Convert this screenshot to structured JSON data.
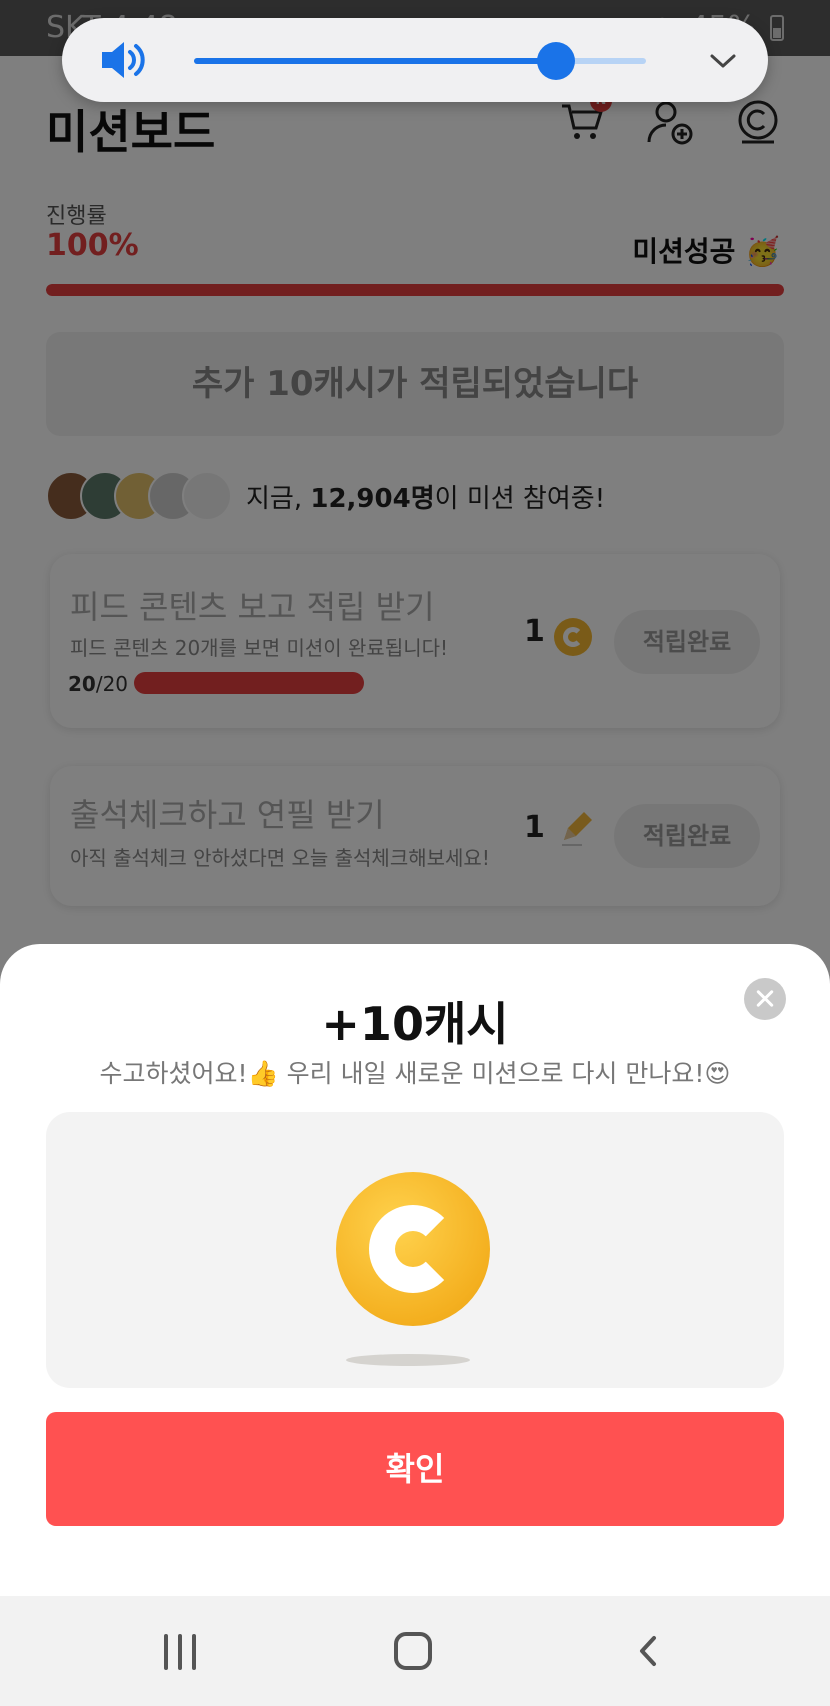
{
  "status_bar": {
    "carrier_time": "SKT 4:48",
    "battery": "45%"
  },
  "volume": {
    "level": 0.8
  },
  "page": {
    "title": "미션보드",
    "cart_badge": "N",
    "progress_label": "진행률",
    "progress_value": "100%",
    "progress_fraction": 1.0,
    "success_text": "미션성공 🥳",
    "bonus_message": "추가 10캐시가 적립되었습니다",
    "participants_prefix": "지금, ",
    "participants_count": "12,904명",
    "participants_suffix": "이 미션 참여중!"
  },
  "missions": [
    {
      "title": "피드 콘텐츠 보고 적립 받기",
      "description": "피드 콘텐츠 20개를 보면 미션이 완료됩니다!",
      "count_done": "20",
      "count_total": "/20",
      "reward": "1",
      "reward_icon": "coin-icon",
      "button": "적립완료"
    },
    {
      "title": "출석체크하고 연필 받기",
      "description": "아직 출석체크 안하셨다면 오늘 출석체크해보세요!",
      "reward": "1",
      "reward_icon": "pencil-icon",
      "button": "적립완료"
    }
  ],
  "sheet": {
    "title": "+10캐시",
    "subtitle": "수고하셨어요!👍 우리 내일 새로운 미션으로 다시 만나요!😍",
    "confirm": "확인"
  },
  "colors": {
    "accent_red": "#e53e3e",
    "confirm_red": "#ff5151",
    "coin_gold": "#f4b020",
    "volume_blue": "#1a73e8"
  }
}
